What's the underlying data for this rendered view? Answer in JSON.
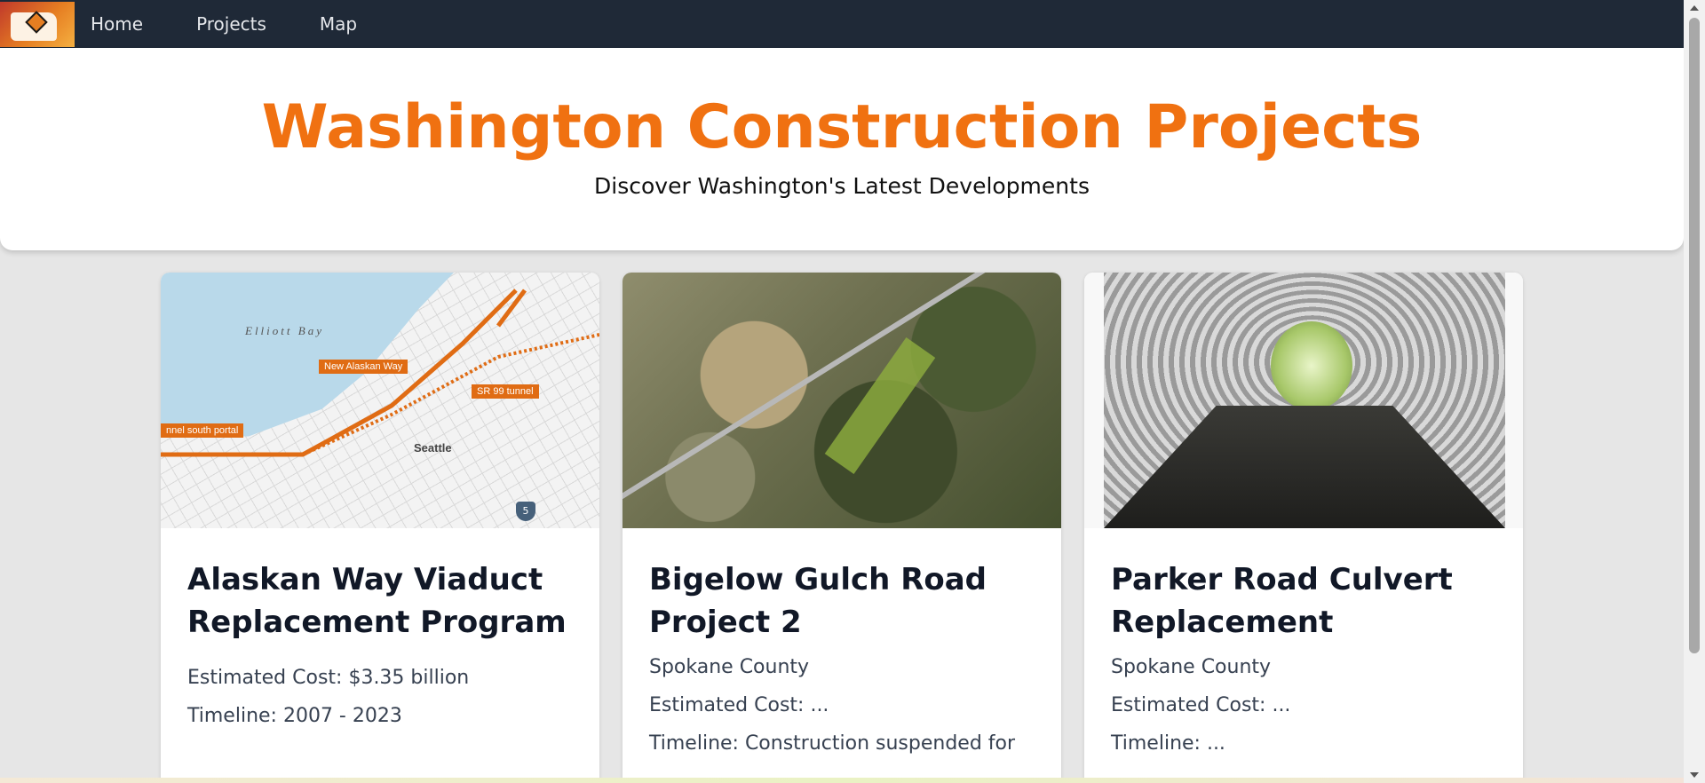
{
  "nav": {
    "links": [
      "Home",
      "Projects",
      "Map"
    ]
  },
  "hero": {
    "title": "Washington Construction Projects",
    "subtitle": "Discover Washington's Latest Developments"
  },
  "cards": [
    {
      "title": "Alaskan Way Viaduct Replacement Program",
      "county": "",
      "cost": "Estimated Cost: $3.35 billion",
      "timeline": "Timeline: 2007 - 2023",
      "image": {
        "labels": [
          "New Alaskan Way",
          "SR 99 tunnel",
          "nnel south portal"
        ],
        "bay": "Elliott Bay",
        "city": "Seattle",
        "route": "5"
      }
    },
    {
      "title": "Bigelow Gulch Road Project 2",
      "county": "Spokane County",
      "cost": "Estimated Cost: ...",
      "timeline": "Timeline: Construction suspended for"
    },
    {
      "title": "Parker Road Culvert Replacement",
      "county": "Spokane County",
      "cost": "Estimated Cost: ...",
      "timeline": "Timeline: ..."
    }
  ],
  "colors": {
    "accent": "#f07111",
    "nav_bg": "#1f2937"
  }
}
